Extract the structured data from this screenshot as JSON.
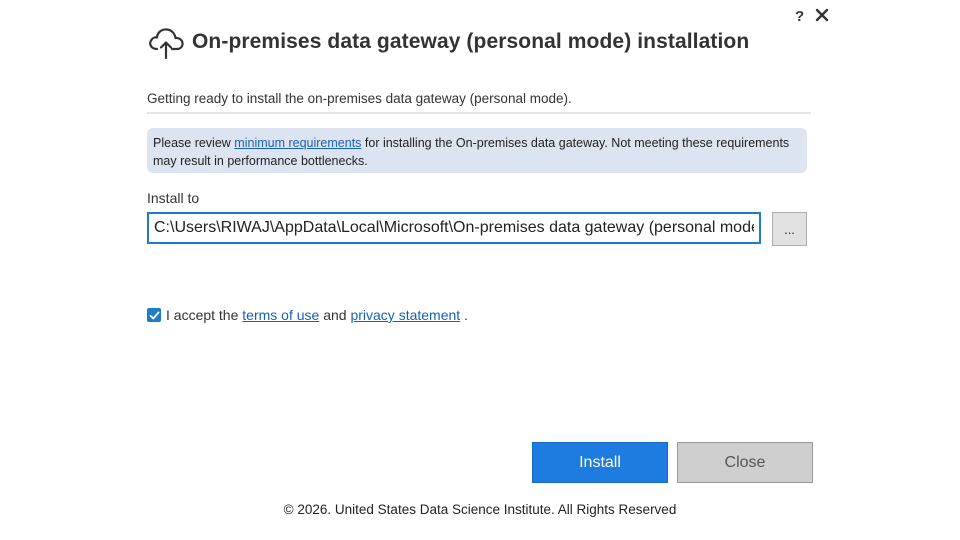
{
  "window": {
    "help_label": "?",
    "close_icon": "close-icon"
  },
  "header": {
    "icon": "cloud-upload-icon",
    "title": "On-premises data gateway (personal mode) installation"
  },
  "subtitle": "Getting ready to install the on-premises data gateway (personal mode).",
  "notice": {
    "prefix": "Please review ",
    "link": "minimum requirements",
    "suffix": " for installing the On-premises data gateway. Not meeting these requirements may result in performance bottlenecks."
  },
  "install_to": {
    "label": "Install to",
    "path": "C:\\Users\\RIWAJ\\AppData\\Local\\Microsoft\\On-premises data gateway (personal mode)",
    "browse_label": "..."
  },
  "accept": {
    "checked": true,
    "prefix": "I accept the ",
    "terms_link": "terms of use",
    "middle": " and ",
    "privacy_link": "privacy statement",
    "suffix": " ."
  },
  "buttons": {
    "install": "Install",
    "close": "Close"
  },
  "colors": {
    "accent": "#1e7bdf",
    "notice_bg": "#dde4f1",
    "link": "#1a5fb4"
  },
  "footer": "© 2026. United States Data Science Institute. All Rights Reserved"
}
